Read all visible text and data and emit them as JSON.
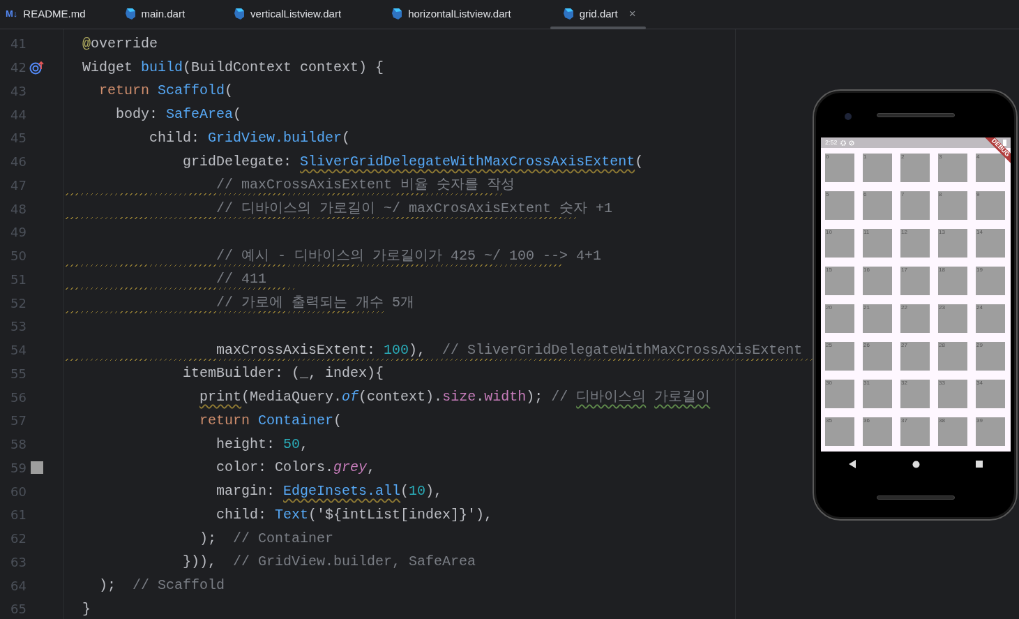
{
  "tabs": [
    {
      "label": "README.md",
      "kind": "markdown",
      "badge": "M↓",
      "selected": false
    },
    {
      "label": "main.dart",
      "kind": "dart",
      "selected": false
    },
    {
      "label": "verticalListview.dart",
      "kind": "dart",
      "selected": false
    },
    {
      "label": "horizontalListview.dart",
      "kind": "dart",
      "selected": false
    },
    {
      "label": "grid.dart",
      "kind": "dart",
      "selected": true,
      "close": "×"
    }
  ],
  "lines": [
    {
      "number": "41",
      "tokens": [
        {
          "text": "@",
          "kind": "annotation"
        },
        {
          "text": "override",
          "kind": "plain"
        }
      ]
    },
    {
      "number": "42",
      "marker": {
        "kind": "override"
      },
      "tokens": [
        {
          "text": "Widget ",
          "kind": "plain"
        },
        {
          "text": "build",
          "kind": "func"
        },
        {
          "text": "(BuildContext context) {",
          "kind": "plain"
        }
      ]
    },
    {
      "number": "43",
      "tokens": [
        {
          "text": "  return",
          "kind": "keyword"
        },
        {
          "text": " Scaffold",
          "kind": "func"
        },
        {
          "text": "(",
          "kind": "plain"
        }
      ]
    },
    {
      "number": "44",
      "tokens": [
        {
          "text": "    body: ",
          "kind": "plain"
        },
        {
          "text": "SafeArea",
          "kind": "func"
        },
        {
          "text": "(",
          "kind": "plain"
        }
      ]
    },
    {
      "number": "45",
      "tokens": [
        {
          "text": "        child: ",
          "kind": "plain"
        },
        {
          "text": "GridView.builder",
          "kind": "func"
        },
        {
          "text": "(",
          "kind": "plain"
        }
      ]
    },
    {
      "number": "46",
      "tokens": [
        {
          "text": "            gridDelegate: ",
          "kind": "plain"
        },
        {
          "text": "SliverGridDelegateWithMaxCrossAxisExtent",
          "kind": "func",
          "warning": true
        },
        {
          "text": "(",
          "kind": "plain"
        }
      ]
    },
    {
      "number": "47",
      "warning": true,
      "tokens": [
        {
          "text": "                // maxCrossAxisExtent 비율 숫자를 작성",
          "kind": "comment"
        }
      ]
    },
    {
      "number": "48",
      "warning": true,
      "tokens": [
        {
          "text": "                // 디바이스의 가로길이 ~/ maxCrosAxisExtent 숫자 +1",
          "kind": "comment"
        }
      ]
    },
    {
      "number": "49"
    },
    {
      "number": "50",
      "warning": true,
      "tokens": [
        {
          "text": "                // 예시 - 디바이스의 가로길이가 425 ~/ 100 --> 4+1",
          "kind": "comment"
        }
      ]
    },
    {
      "number": "51",
      "warning": true,
      "tokens": [
        {
          "text": "                // 411",
          "kind": "comment"
        }
      ]
    },
    {
      "number": "52",
      "warning": true,
      "tokens": [
        {
          "text": "                // 가로에 출력되는 개수 5개",
          "kind": "comment"
        }
      ]
    },
    {
      "number": "53"
    },
    {
      "number": "54",
      "warning": true,
      "tokens": [
        {
          "text": "                maxCrossAxisExtent: ",
          "kind": "plain"
        },
        {
          "text": "100",
          "kind": "number"
        },
        {
          "text": "),  ",
          "kind": "plain"
        },
        {
          "text": "// SliverGridDelegateWithMaxCrossAxisExtent",
          "kind": "comment"
        }
      ]
    },
    {
      "number": "55",
      "tokens": [
        {
          "text": "            itemBuilder: (_, index){",
          "kind": "plain"
        }
      ]
    },
    {
      "number": "56",
      "tokens": [
        {
          "text": "              print",
          "kind": "plain",
          "warning": true
        },
        {
          "text": "(MediaQuery.",
          "kind": "plain"
        },
        {
          "text": "of",
          "kind": "italic"
        },
        {
          "text": "(context).",
          "kind": "plain"
        },
        {
          "text": "size",
          "kind": "prop"
        },
        {
          "text": ".",
          "kind": "plain"
        },
        {
          "text": "width",
          "kind": "prop"
        },
        {
          "text": "); ",
          "kind": "plain"
        },
        {
          "text": "// ",
          "kind": "comment"
        },
        {
          "text": "디바이스의",
          "kind": "comment",
          "typo": true
        },
        {
          "text": " 가로길이",
          "kind": "comment",
          "typo": true
        }
      ]
    },
    {
      "number": "57",
      "tokens": [
        {
          "text": "              return",
          "kind": "keyword"
        },
        {
          "text": " Container",
          "kind": "func"
        },
        {
          "text": "(",
          "kind": "plain"
        }
      ]
    },
    {
      "number": "58",
      "tokens": [
        {
          "text": "                height: ",
          "kind": "plain"
        },
        {
          "text": "50",
          "kind": "number"
        },
        {
          "text": ",",
          "kind": "plain"
        }
      ]
    },
    {
      "number": "59",
      "marker": {
        "kind": "color",
        "color": "#9e9e9e"
      },
      "tokens": [
        {
          "text": "                color: Colors.",
          "kind": "plain"
        },
        {
          "text": "grey",
          "kind": "italic-prop"
        },
        {
          "text": ",",
          "kind": "plain"
        }
      ]
    },
    {
      "number": "60",
      "tokens": [
        {
          "text": "                margin: ",
          "kind": "plain"
        },
        {
          "text": "EdgeInsets.all",
          "kind": "func",
          "warning": true
        },
        {
          "text": "(",
          "kind": "plain"
        },
        {
          "text": "10",
          "kind": "number"
        },
        {
          "text": "),",
          "kind": "plain"
        }
      ]
    },
    {
      "number": "61",
      "tokens": [
        {
          "text": "                child: ",
          "kind": "plain"
        },
        {
          "text": "Text",
          "kind": "func"
        },
        {
          "text": "('${intList[index]}'),",
          "kind": "plain"
        }
      ]
    },
    {
      "number": "62",
      "tokens": [
        {
          "text": "              );  ",
          "kind": "plain"
        },
        {
          "text": "// Container",
          "kind": "comment"
        }
      ]
    },
    {
      "number": "63",
      "tokens": [
        {
          "text": "            })),  ",
          "kind": "plain"
        },
        {
          "text": "// GridView.builder, SafeArea",
          "kind": "comment"
        }
      ]
    },
    {
      "number": "64",
      "tokens": [
        {
          "text": "  );  ",
          "kind": "plain"
        },
        {
          "text": "// Scaffold",
          "kind": "comment"
        }
      ]
    },
    {
      "number": "65",
      "tokens": [
        {
          "text": "}",
          "kind": "plain"
        }
      ]
    }
  ],
  "emulator": {
    "status_time": "2:52",
    "debug_banner": "DEBUG",
    "tiles": [
      "0",
      "1",
      "2",
      "3",
      "4",
      "5",
      "6",
      "7",
      "8",
      "9",
      "10",
      "11",
      "12",
      "13",
      "14",
      "15",
      "16",
      "17",
      "18",
      "19",
      "20",
      "21",
      "22",
      "23",
      "24",
      "25",
      "26",
      "27",
      "28",
      "29",
      "30",
      "31",
      "32",
      "33",
      "34",
      "35",
      "36",
      "37",
      "38",
      "39"
    ]
  }
}
